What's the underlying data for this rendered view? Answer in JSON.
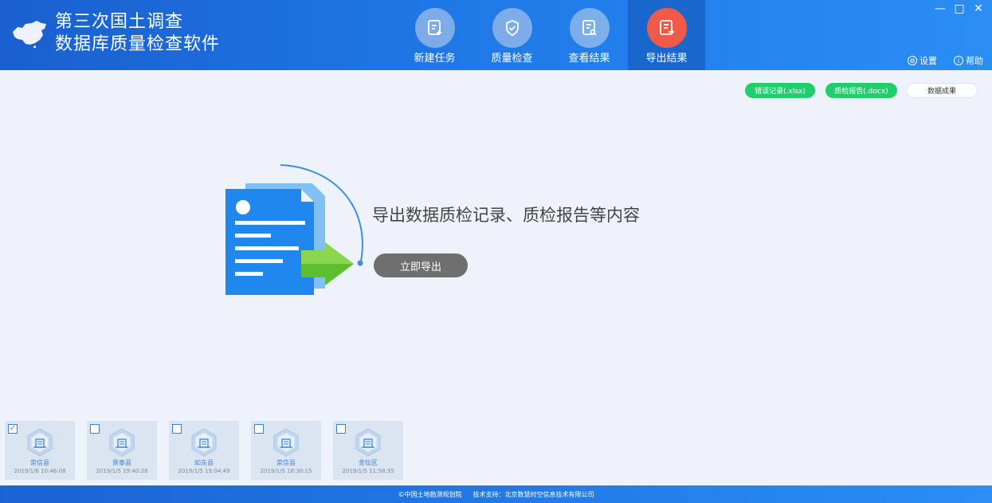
{
  "app": {
    "title_line1": "第三次国土调查",
    "title_line2": "数据库质量检查软件"
  },
  "nav": [
    {
      "label": "新建任务",
      "icon": "new-task-icon"
    },
    {
      "label": "质量检查",
      "icon": "shield-check-icon"
    },
    {
      "label": "查看结果",
      "icon": "view-result-icon"
    },
    {
      "label": "导出结果",
      "icon": "export-result-icon",
      "active": true
    }
  ],
  "window": {
    "minimize": "—",
    "maximize": "□",
    "close": "✕"
  },
  "utils": {
    "settings": "设置",
    "help": "帮助"
  },
  "chips": {
    "error_record": "错误记录(.xlsx)",
    "qc_report": "质检报告(.docx)",
    "data_result": "数据成果"
  },
  "main": {
    "title": "导出数据质检记录、质检报告等内容",
    "export_button": "立即导出"
  },
  "tasks": [
    {
      "name": "崇信县",
      "time": "2019/1/6 10:46:08",
      "checked": true
    },
    {
      "name": "景泰县",
      "time": "2019/1/5 19:40:28",
      "checked": false
    },
    {
      "name": "如东县",
      "time": "2019/1/5 19:04:49",
      "checked": false
    },
    {
      "name": "崇信县",
      "time": "2019/1/5 18:30:15",
      "checked": false
    },
    {
      "name": "金坛区",
      "time": "2019/1/5 11:58:35",
      "checked": false
    }
  ],
  "footer": {
    "copyright": "©中国土地勘测规划院",
    "support": "技术支持：北京数慧时空信息技术有限公司"
  },
  "colors": {
    "header_blue": "#1f78e6",
    "active_red": "#ef5a48",
    "chip_green": "#1fcf6b"
  }
}
